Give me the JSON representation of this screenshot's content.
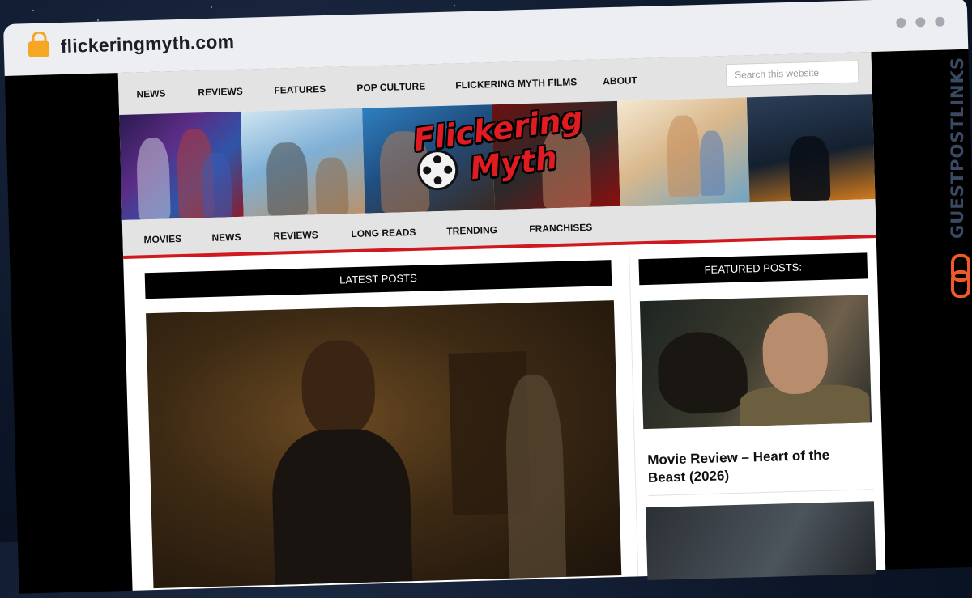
{
  "browser": {
    "url": "flickeringmyth.com"
  },
  "site": {
    "top_nav": [
      "NEWS",
      "REVIEWS",
      "FEATURES",
      "POP CULTURE",
      "FLICKERING MYTH FILMS",
      "ABOUT"
    ],
    "search_placeholder": "Search this website",
    "logo": {
      "line1": "Flickering",
      "line2": "Myth"
    },
    "sub_nav": [
      "MOVIES",
      "NEWS",
      "REVIEWS",
      "LONG READS",
      "TRENDING",
      "FRANCHISES"
    ],
    "latest_heading": "LATEST POSTS",
    "featured_heading": "FEATURED POSTS:",
    "featured_post_title": "Movie Review – Heart of the Beast (2026)"
  },
  "watermark": {
    "text": "GUESTPOSTLINKS"
  },
  "colors": {
    "accent_red": "#d0191f",
    "watermark_orange": "#f05a28",
    "nav_bg": "#e3e3e3"
  }
}
